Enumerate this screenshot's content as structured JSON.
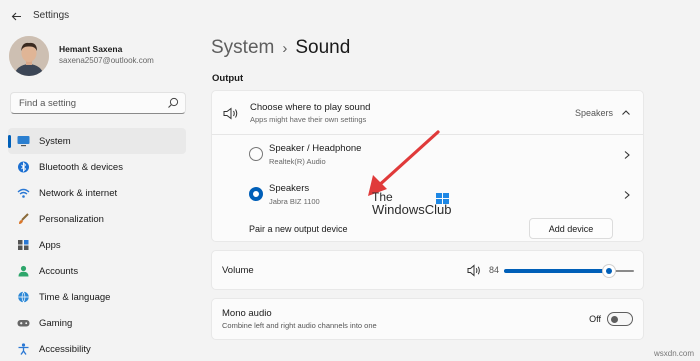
{
  "window": {
    "title": "Settings"
  },
  "user": {
    "name": "Hemant Saxena",
    "email": "saxena2507@outlook.com"
  },
  "search": {
    "placeholder": "Find a setting"
  },
  "sidebar": {
    "items": [
      {
        "label": "System",
        "icon": "monitor-icon",
        "active": true
      },
      {
        "label": "Bluetooth & devices",
        "icon": "bluetooth-icon"
      },
      {
        "label": "Network & internet",
        "icon": "wifi-icon"
      },
      {
        "label": "Personalization",
        "icon": "brush-icon"
      },
      {
        "label": "Apps",
        "icon": "apps-icon"
      },
      {
        "label": "Accounts",
        "icon": "person-icon"
      },
      {
        "label": "Time & language",
        "icon": "globe-icon"
      },
      {
        "label": "Gaming",
        "icon": "gamepad-icon"
      },
      {
        "label": "Accessibility",
        "icon": "accessibility-icon"
      }
    ]
  },
  "breadcrumb": {
    "parent": "System",
    "separator": "›",
    "current": "Sound"
  },
  "output": {
    "section_label": "Output",
    "choose": {
      "title": "Choose where to play sound",
      "subtitle": "Apps might have their own settings",
      "value": "Speakers",
      "expanded": true
    },
    "devices": [
      {
        "name": "Speaker / Headphone",
        "sub": "Realtek(R) Audio",
        "selected": false
      },
      {
        "name": "Speakers",
        "sub": "Jabra BIZ 1100",
        "selected": true
      }
    ],
    "pair": {
      "label": "Pair a new output device",
      "button": "Add device"
    }
  },
  "volume": {
    "label": "Volume",
    "value": "84",
    "level": 0.84
  },
  "mono": {
    "title": "Mono audio",
    "subtitle": "Combine left and right audio channels into one",
    "state": "Off",
    "enabled": false
  },
  "watermark": {
    "line1": "The",
    "line2": "WindowsClub"
  },
  "footer": {
    "text": "wsxdn.com"
  },
  "colors": {
    "accent": "#005fb8",
    "background": "#f3f3f3",
    "card": "#fbfbfb",
    "annotation": "#e03a3a"
  }
}
